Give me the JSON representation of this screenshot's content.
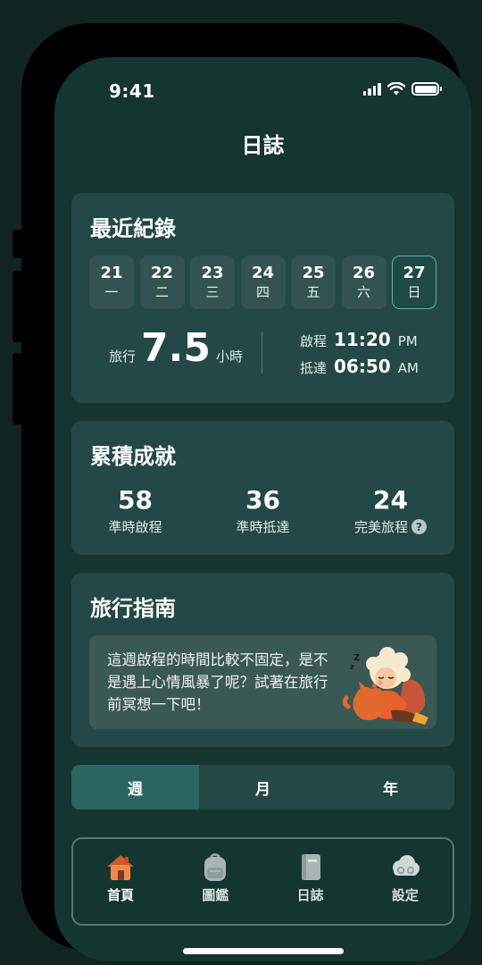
{
  "status": {
    "time": "9:41"
  },
  "page_title": "日誌",
  "recent": {
    "title": "最近紀錄",
    "days": [
      {
        "num": "21",
        "weekday": "一",
        "active": false
      },
      {
        "num": "22",
        "weekday": "二",
        "active": false
      },
      {
        "num": "23",
        "weekday": "三",
        "active": false
      },
      {
        "num": "24",
        "weekday": "四",
        "active": false
      },
      {
        "num": "25",
        "weekday": "五",
        "active": false
      },
      {
        "num": "26",
        "weekday": "六",
        "active": false
      },
      {
        "num": "27",
        "weekday": "日",
        "active": true
      }
    ],
    "travel_label": "旅行",
    "travel_value": "7.5",
    "travel_unit": "小時",
    "depart_label": "啟程",
    "depart_time": "11:20",
    "depart_ampm": "PM",
    "arrive_label": "抵達",
    "arrive_time": "06:50",
    "arrive_ampm": "AM"
  },
  "achievements": {
    "title": "累積成就",
    "items": [
      {
        "value": "58",
        "label": "準時啟程"
      },
      {
        "value": "36",
        "label": "準時抵達"
      },
      {
        "value": "24",
        "label": "完美旅程"
      }
    ],
    "help_glyph": "?"
  },
  "guide": {
    "title": "旅行指南",
    "text": "這週啟程的時間比較不固定，是不是遇上心情風暴了呢？試著在旅行前冥想一下吧！"
  },
  "period_tabs": [
    {
      "label": "週",
      "active": true
    },
    {
      "label": "月",
      "active": false
    },
    {
      "label": "年",
      "active": false
    }
  ],
  "nav": [
    {
      "label": "首頁",
      "icon": "house-icon",
      "active": true
    },
    {
      "label": "圖鑑",
      "icon": "backpack-icon",
      "active": false
    },
    {
      "label": "日誌",
      "icon": "book-icon",
      "active": false
    },
    {
      "label": "設定",
      "icon": "cloud-gear-icon",
      "active": false
    }
  ],
  "colors": {
    "background": "#102420",
    "screen": "#143530",
    "card": "#234845",
    "active_segment": "#2a6562",
    "active_day_border": "#5bb3a4"
  }
}
